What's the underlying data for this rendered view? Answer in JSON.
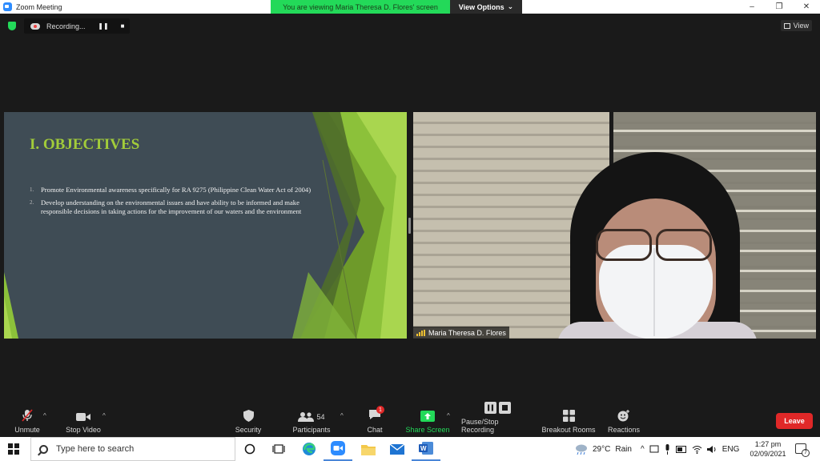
{
  "window": {
    "title": "Zoom Meeting",
    "minimize_glyph": "–",
    "restore_glyph": "❐",
    "close_glyph": "✕"
  },
  "share_banner": {
    "message": "You are viewing Maria Theresa D. Flores' screen",
    "options_label": "View Options"
  },
  "recording": {
    "label": "Recording...",
    "pause_glyph": "❚❚",
    "stop_glyph": "■"
  },
  "view_button": {
    "label": "View"
  },
  "slide": {
    "heading": "I. OBJECTIVES",
    "items": [
      {
        "num": "1.",
        "text": "Promote Environmental awareness specifically for RA 9275 (Philippine Clean Water Act of 2004)"
      },
      {
        "num": "2.",
        "text": "Develop understanding on the environmental issues and have ability to be informed and make responsible decisions in taking actions for the improvement of our waters and the environment"
      }
    ]
  },
  "video": {
    "participant_name": "Maria Theresa D. Flores"
  },
  "toolbar": {
    "unmute": "Unmute",
    "stop_video": "Stop Video",
    "security": "Security",
    "participants": "Participants",
    "participants_count": "54",
    "chat": "Chat",
    "chat_badge": "1",
    "share_screen": "Share Screen",
    "pause_stop_recording": "Pause/Stop Recording",
    "breakout_rooms": "Breakout Rooms",
    "reactions": "Reactions",
    "leave": "Leave",
    "caret": "^"
  },
  "taskbar": {
    "search_placeholder": "Type here to search",
    "weather_temp": "29°C",
    "weather_text": "Rain",
    "language": "ENG",
    "time": "1:27 pm",
    "date": "02/09/2021",
    "notifications_count": "7"
  },
  "colors": {
    "accent_green": "#23d959",
    "leave_red": "#e02828",
    "slide_bg": "#3f4c55",
    "slide_heading": "#a2cc3a"
  }
}
